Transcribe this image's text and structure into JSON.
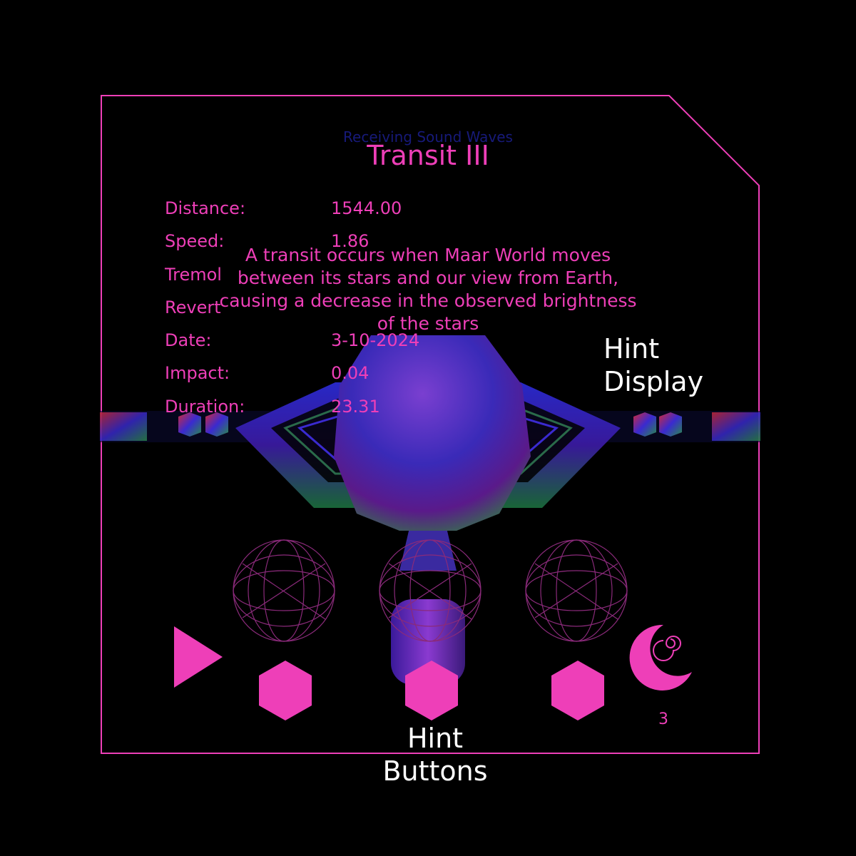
{
  "panel": {
    "subtitle": "Receiving Sound Waves",
    "title": "Transit III"
  },
  "stats": [
    {
      "label": "Distance:",
      "value": "1544.00"
    },
    {
      "label": "Speed:",
      "value": "1.86"
    },
    {
      "label": "Tremol",
      "value": ""
    },
    {
      "label": "Revert",
      "value": ""
    },
    {
      "label": "Date:",
      "value": "3-10-2024"
    },
    {
      "label": "Impact:",
      "value": "0.04"
    },
    {
      "label": "Duration:",
      "value": "23.31"
    }
  ],
  "hint": {
    "text": "A transit occurs when Maar World moves between its stars and our view from Earth, causing a decrease in the observed brightness of the stars"
  },
  "annotations": {
    "hint_display": "Hint Display",
    "hint_buttons": "Hint Buttons"
  },
  "controls": {
    "play_icon": "play-triangle-icon",
    "hint_button_icon": "hexagon-icon",
    "sphere_icon": "wireframe-sphere-icon",
    "moon_icon": "crescent-moon-spiral-icon",
    "hints_remaining": "3"
  },
  "colors": {
    "accent": "#ee3fb8",
    "subtitle": "#1a1d88",
    "background": "#000000",
    "annotation": "#ffffff"
  }
}
